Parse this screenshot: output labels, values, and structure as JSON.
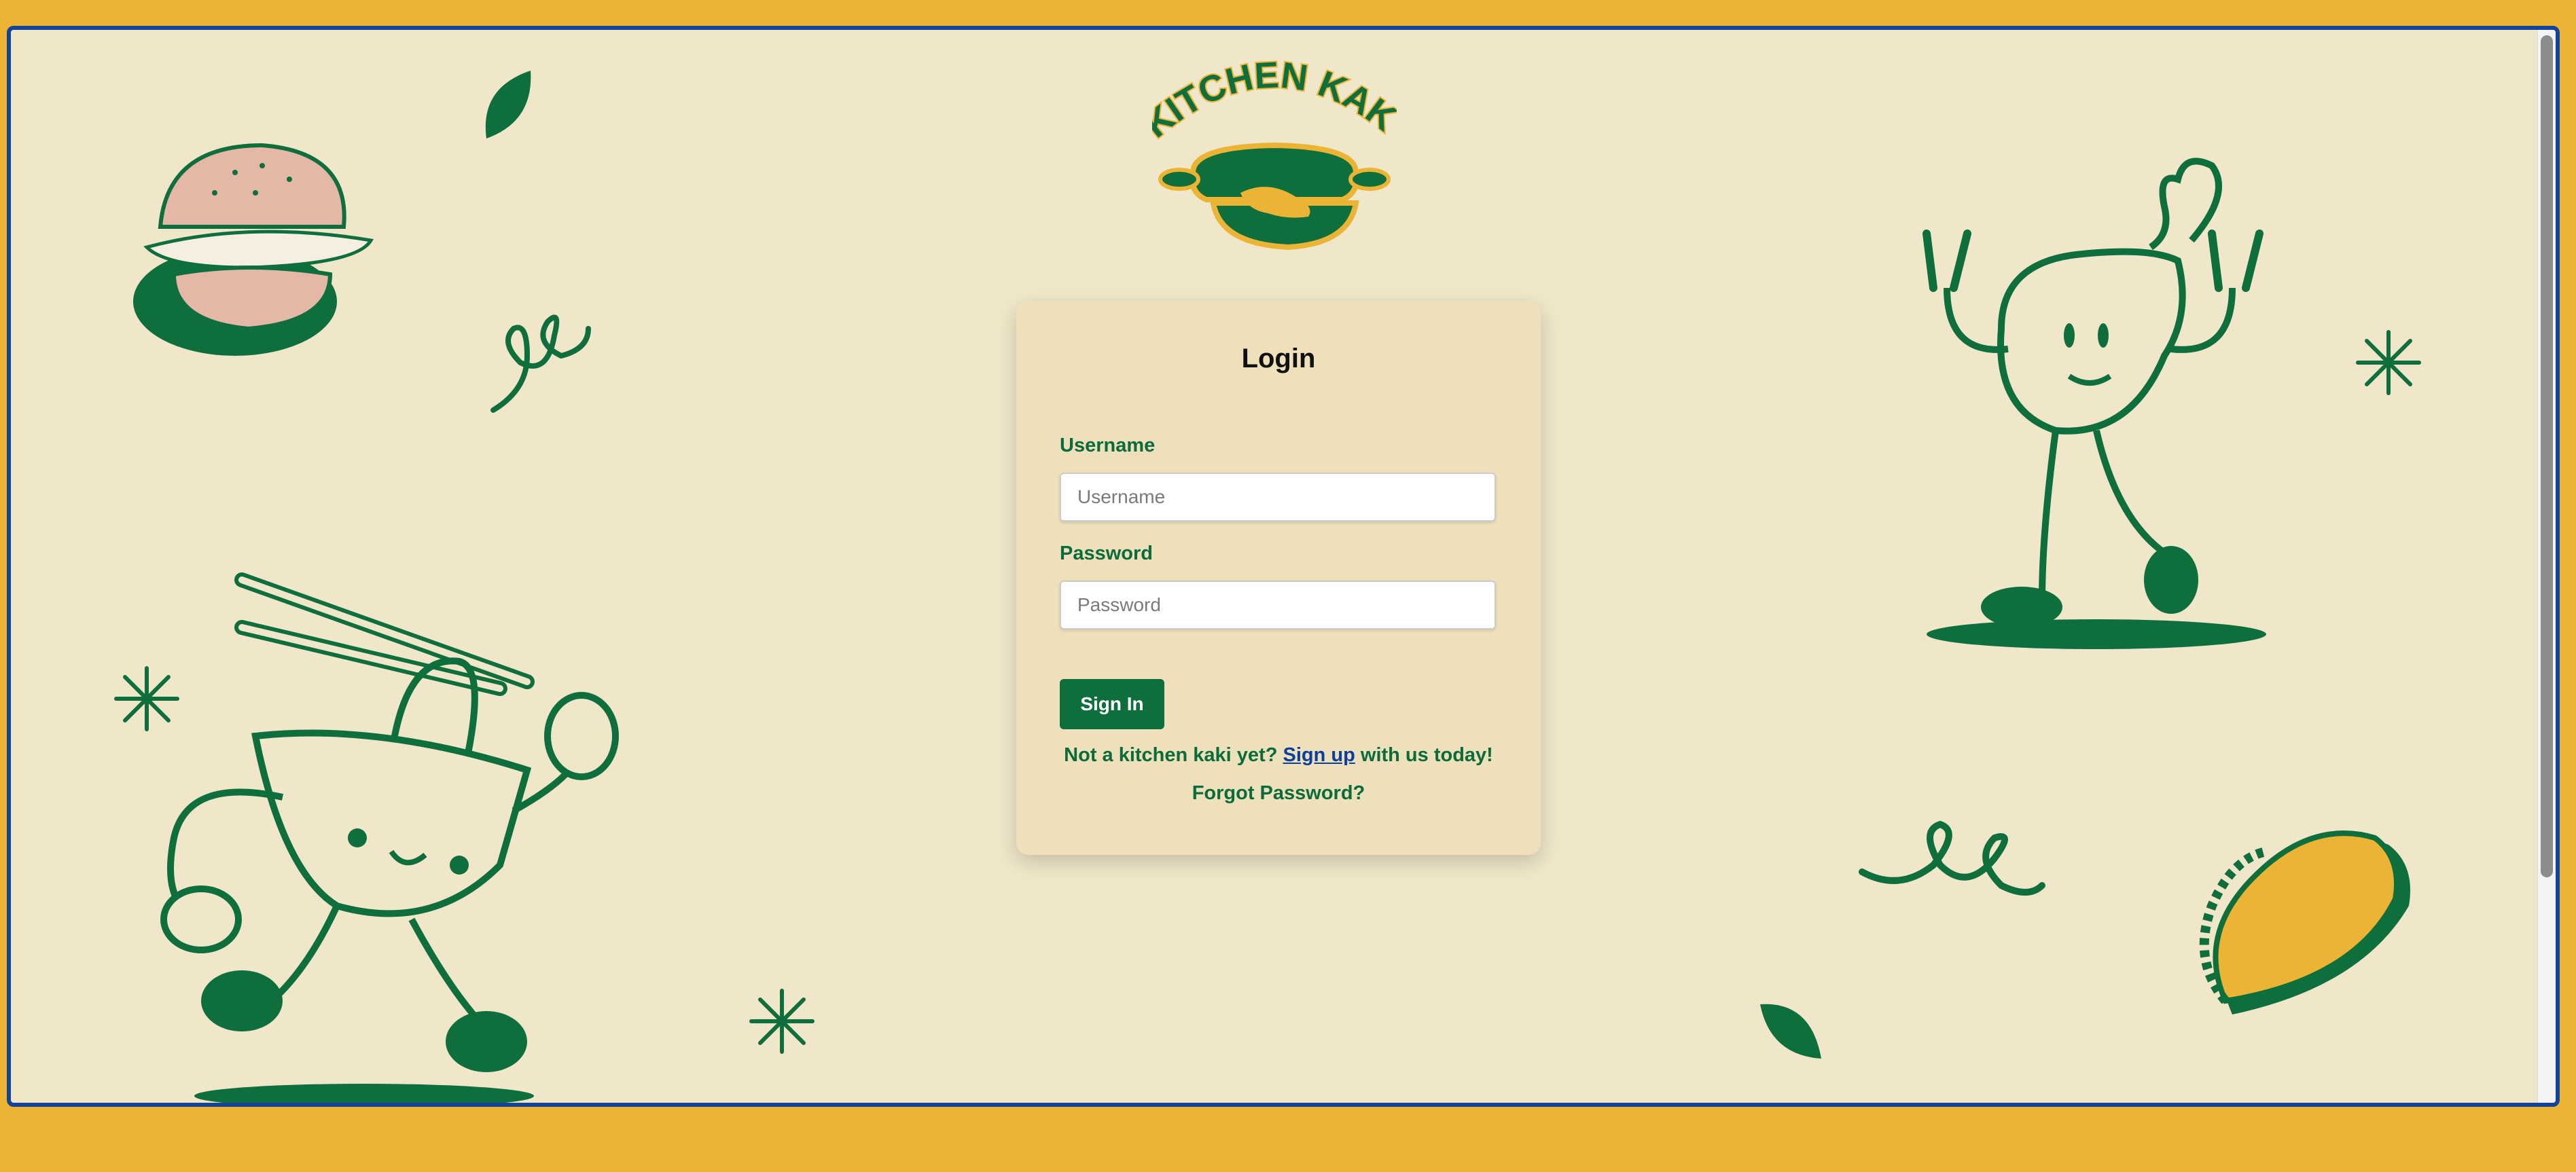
{
  "colors": {
    "background": "#ecb435",
    "frame_border": "#14449a",
    "page": "#f0e6c9",
    "card": "#ede0bb",
    "brand_green": "#0e6f3d",
    "link_blue": "#0a3f9c"
  },
  "logo": {
    "text": "KITCHEN KAKI"
  },
  "login": {
    "title": "Login",
    "username": {
      "label": "Username",
      "value": "",
      "placeholder": "Username"
    },
    "password": {
      "label": "Password",
      "value": "",
      "placeholder": "Password"
    },
    "sign_in_label": "Sign In",
    "signup_prompt_before": "Not a kitchen kaki yet?",
    "signup_link": "Sign up",
    "signup_prompt_after": "with us today!",
    "forgot_password": "Forgot Password?"
  },
  "illustrations": [
    "burger-icon",
    "leaf-icon",
    "squiggle-icon",
    "noodle-bowl-character-icon",
    "sparkle-icon",
    "chicken-drumstick-character-icon",
    "taco-icon"
  ]
}
